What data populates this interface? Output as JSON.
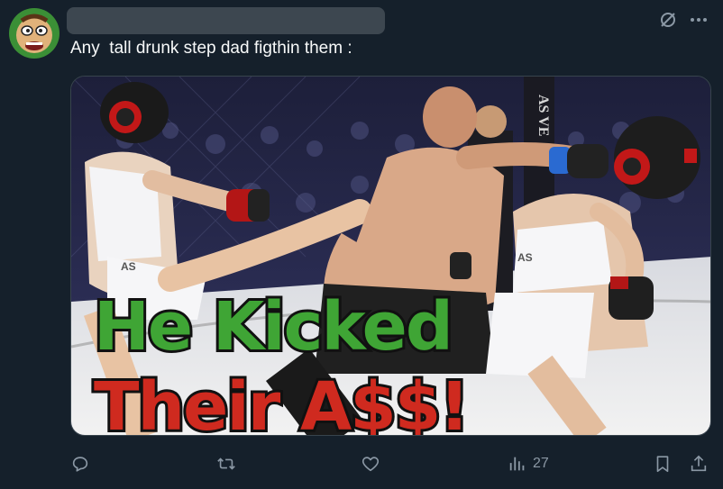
{
  "tweet": {
    "text": "Any  tall drunk step dad figthin them :"
  },
  "media": {
    "headline_line1": "He Kicked",
    "headline_line2": "Their A$$!",
    "banner_text": "AS VE",
    "shorts_text_left": "AS",
    "shorts_text_right": "AS"
  },
  "actions": {
    "views_count": "27"
  },
  "colors": {
    "background": "#15202b",
    "icon": "#8b98a5",
    "headline_green": "#3fa535",
    "headline_red": "#cf2a1f"
  },
  "icons": [
    "avatar",
    "grok-icon",
    "more-icon",
    "reply-icon",
    "retweet-icon",
    "like-icon",
    "views-icon",
    "bookmark-icon",
    "share-icon"
  ]
}
